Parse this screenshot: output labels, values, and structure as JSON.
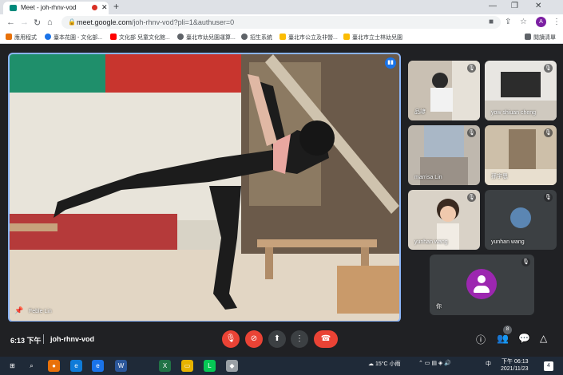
{
  "browser": {
    "tab_title": "Meet - joh-rhnv-vod",
    "tab_close": "✕",
    "new_tab": "+",
    "window_minimize": "—",
    "window_restore": "❐",
    "window_close": "✕",
    "url_host": "meet.google.com",
    "url_path": "/joh-rhnv-vod?pli=1&authuser=0",
    "profile_initial": "A",
    "reading_list_label": "閱讀清單",
    "bookmarks": [
      {
        "label": "應用程式",
        "icon": "apps-grid-icon",
        "color": "#e8710a"
      },
      {
        "label": "臺本花園 - 文化部...",
        "icon": "site-icon",
        "color": "#1a73e8"
      },
      {
        "label": "文化部 兒童文化館...",
        "icon": "youtube-icon",
        "color": "#ff0000"
      },
      {
        "label": "臺北市幼兒園運算...",
        "icon": "site-icon",
        "color": "#5f6368"
      },
      {
        "label": "招生系統",
        "icon": "site-icon",
        "color": "#5f6368"
      },
      {
        "label": "臺北市公立及非營...",
        "icon": "site-icon",
        "color": "#fbbc04"
      },
      {
        "label": "臺北市立士林幼兒園",
        "icon": "site-icon",
        "color": "#fbbc04"
      }
    ]
  },
  "meet": {
    "main_speaker": "Feble Lin",
    "participants": [
      {
        "name": "品諺",
        "muted": true
      },
      {
        "name": "yow shiuan cheng",
        "muted": true
      },
      {
        "name": "marrisa Lin",
        "muted": true
      },
      {
        "name": "孫宇恩",
        "muted": true
      },
      {
        "name": "yunhan wang",
        "muted": true
      },
      {
        "name": "yunhan wang",
        "muted": true
      },
      {
        "name": "你",
        "muted": true
      }
    ],
    "clock": "6:13 下午",
    "meeting_code": "joh-rhnv-vod",
    "participant_count": "8",
    "colors": {
      "accent": "#8ab4f8",
      "danger": "#ea4335",
      "self_avatar": "#9c27b0"
    }
  },
  "taskbar": {
    "weather": "15°C 小雨",
    "time": "下午 06:13",
    "date": "2021/11/23",
    "notifications": "4",
    "lang": "中"
  }
}
